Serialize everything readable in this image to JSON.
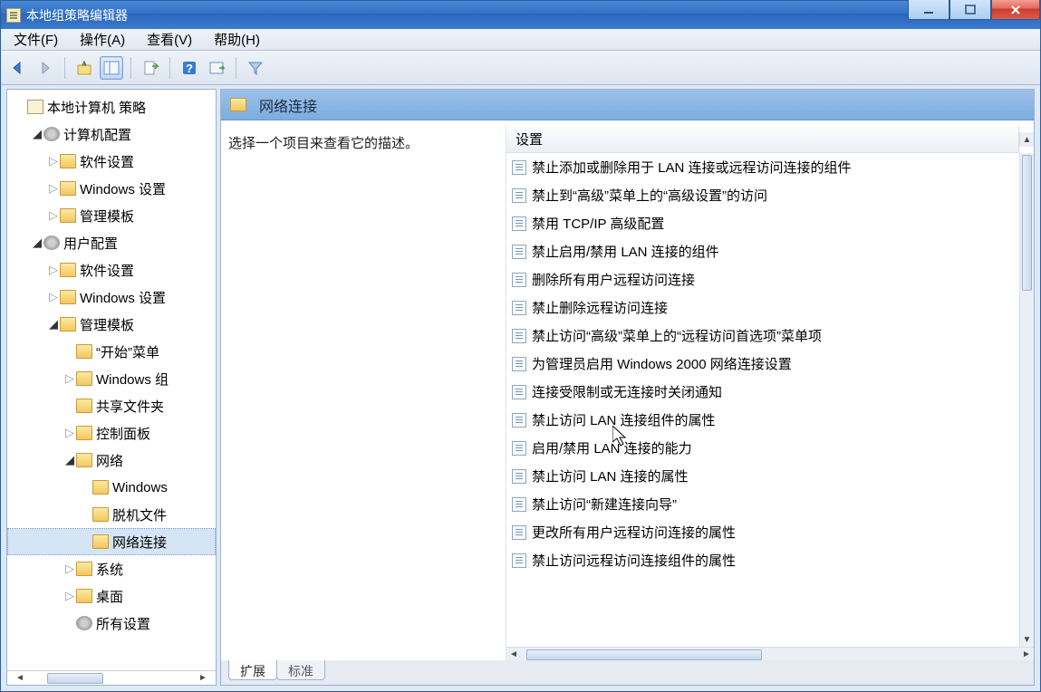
{
  "window": {
    "title": "本地组策略编辑器"
  },
  "menubar": {
    "file": "文件(F)",
    "action": "操作(A)",
    "view": "查看(V)",
    "help": "帮助(H)"
  },
  "tree": [
    {
      "indent": 0,
      "icon": "doc",
      "exp": "none",
      "label": "本地计算机 策略",
      "name": "tree-root"
    },
    {
      "indent": 1,
      "icon": "gear",
      "exp": "open",
      "label": "计算机配置",
      "name": "tree-computer-config"
    },
    {
      "indent": 2,
      "icon": "folder",
      "exp": "closed",
      "label": "软件设置",
      "name": "tree-cc-software"
    },
    {
      "indent": 2,
      "icon": "folder",
      "exp": "closed",
      "label": "Windows 设置",
      "name": "tree-cc-windows"
    },
    {
      "indent": 2,
      "icon": "folder",
      "exp": "closed",
      "label": "管理模板",
      "name": "tree-cc-admin"
    },
    {
      "indent": 1,
      "icon": "gear",
      "exp": "open",
      "label": "用户配置",
      "name": "tree-user-config"
    },
    {
      "indent": 2,
      "icon": "folder",
      "exp": "closed",
      "label": "软件设置",
      "name": "tree-uc-software"
    },
    {
      "indent": 2,
      "icon": "folder",
      "exp": "closed",
      "label": "Windows 设置",
      "name": "tree-uc-windows"
    },
    {
      "indent": 2,
      "icon": "folder",
      "exp": "open",
      "label": "管理模板",
      "name": "tree-uc-admin"
    },
    {
      "indent": 3,
      "icon": "folder",
      "exp": "none",
      "label": "“开始”菜单",
      "name": "tree-start-menu"
    },
    {
      "indent": 3,
      "icon": "folder",
      "exp": "closed",
      "label": "Windows 组",
      "name": "tree-windows-comp"
    },
    {
      "indent": 3,
      "icon": "folder",
      "exp": "none",
      "label": "共享文件夹",
      "name": "tree-shared-folders"
    },
    {
      "indent": 3,
      "icon": "folder",
      "exp": "closed",
      "label": "控制面板",
      "name": "tree-control-panel"
    },
    {
      "indent": 3,
      "icon": "folder",
      "exp": "open",
      "label": "网络",
      "name": "tree-network"
    },
    {
      "indent": 4,
      "icon": "folder",
      "exp": "none",
      "label": "Windows",
      "name": "tree-net-windows"
    },
    {
      "indent": 4,
      "icon": "folder",
      "exp": "none",
      "label": "脱机文件",
      "name": "tree-net-offline"
    },
    {
      "indent": 4,
      "icon": "folder",
      "exp": "none",
      "label": "网络连接",
      "selected": true,
      "name": "tree-net-connections"
    },
    {
      "indent": 3,
      "icon": "folder",
      "exp": "closed",
      "label": "系统",
      "name": "tree-system"
    },
    {
      "indent": 3,
      "icon": "folder",
      "exp": "closed",
      "label": "桌面",
      "name": "tree-desktop"
    },
    {
      "indent": 3,
      "icon": "gear",
      "exp": "none",
      "label": "所有设置",
      "name": "tree-all-settings"
    }
  ],
  "rightHeader": {
    "title": "网络连接"
  },
  "description": "选择一个项目来查看它的描述。",
  "listHeader": {
    "column1": "设置"
  },
  "settings": [
    "禁止添加或删除用于 LAN 连接或远程访问连接的组件",
    "禁止到“高级”菜单上的“高级设置”的访问",
    "禁用 TCP/IP 高级配置",
    "禁止启用/禁用 LAN 连接的组件",
    "删除所有用户远程访问连接",
    "禁止删除远程访问连接",
    "禁止访问“高级”菜单上的“远程访问首选项”菜单项",
    "为管理员启用 Windows 2000 网络连接设置",
    "连接受限制或无连接时关闭通知",
    "禁止访问 LAN 连接组件的属性",
    "启用/禁用 LAN 连接的能力",
    "禁止访问 LAN 连接的属性",
    "禁止访问“新建连接向导”",
    "更改所有用户远程访问连接的属性",
    "禁止访问远程访问连接组件的属性"
  ],
  "tabs": {
    "extended": "扩展",
    "standard": "标准"
  }
}
